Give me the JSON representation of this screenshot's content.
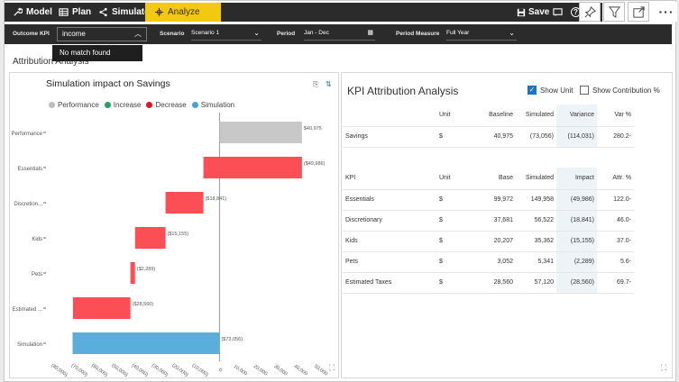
{
  "toolbar": {
    "model": "Model",
    "plan": "Plan",
    "simulate": "Simulate",
    "analyze": "Analyze",
    "save": "Save",
    "help": "?"
  },
  "filters": {
    "outcome_kpi_label": "Outcome KPI",
    "outcome_kpi_value": "income",
    "dropdown_message": "No match found",
    "scenario_label": "Scenario",
    "scenario_value": "Scenario 1",
    "period_label": "Period",
    "period_value": "Jan - Dec",
    "period_measure_label": "Period Measure",
    "period_measure_value": "Full Year"
  },
  "section_title": "Attribution Analysis",
  "left": {
    "title": "Simulation impact on Savings",
    "legend": [
      {
        "name": "Performance",
        "color": "#bdbdbd"
      },
      {
        "name": "Increase",
        "color": "#21a366"
      },
      {
        "name": "Decrease",
        "color": "#e81123"
      },
      {
        "name": "Simulation",
        "color": "#41a1d9"
      }
    ]
  },
  "chart_data": {
    "type": "bar",
    "orientation": "horizontal-waterfall",
    "categories": [
      "Performance",
      "Essentials",
      "Discretion...",
      "Kids",
      "Pets",
      "Estimated ...",
      "Simulation"
    ],
    "series": [
      {
        "name": "Performance",
        "color": "#c8c8c8",
        "bars": [
          {
            "category": "Performance",
            "start": 0,
            "end": 40975,
            "label": "$40,975"
          }
        ]
      },
      {
        "name": "Decrease",
        "color": "#fc4f55",
        "bars": [
          {
            "category": "Essentials",
            "start": -8011,
            "end": 40975,
            "label": "($49,986)"
          },
          {
            "category": "Discretion...",
            "start": -26852,
            "end": -8011,
            "label": "($18,841)"
          },
          {
            "category": "Kids",
            "start": -42007,
            "end": -26852,
            "label": "($15,155)"
          },
          {
            "category": "Pets",
            "start": -44296,
            "end": -42007,
            "label": "($2,289)"
          },
          {
            "category": "Estimated ...",
            "start": -72856,
            "end": -44296,
            "label": "($28,560)"
          }
        ]
      },
      {
        "name": "Simulation",
        "color": "#5aaedb",
        "bars": [
          {
            "category": "Simulation",
            "start": -73056,
            "end": 0,
            "label": "($73,056)"
          }
        ]
      }
    ],
    "xticks": [
      "(80,000)",
      "(70,000)",
      "(60,000)",
      "(50,000)",
      "(40,000)",
      "(30,000)",
      "(20,000)",
      "(10,000)",
      "0",
      "10,000",
      "20,000",
      "30,000",
      "40,000",
      "50,000"
    ],
    "xlim": [
      -80000,
      50000
    ]
  },
  "right": {
    "title": "KPI Attribution Analysis",
    "show_unit": "Show Unit",
    "show_contribution": "Show Contribution %",
    "summary_headers": [
      "",
      "Unit",
      "Baseline",
      "Simulated",
      "Variance",
      "Var %"
    ],
    "summary_rows": [
      [
        "Savings",
        "$",
        "40,975",
        "(73,056)",
        "(114,031)",
        "280.2-"
      ]
    ],
    "kpi_headers": [
      "KPI",
      "Unit",
      "Base",
      "Simulated",
      "Impact",
      "Attr. %"
    ],
    "kpi_rows": [
      [
        "Essentials",
        "$",
        "99,972",
        "149,958",
        "(49,986)",
        "122.0-"
      ],
      [
        "Discretionary",
        "$",
        "37,681",
        "56,522",
        "(18,841)",
        "46.0-"
      ],
      [
        "Kids",
        "$",
        "20,207",
        "35,362",
        "(15,155)",
        "37.0-"
      ],
      [
        "Pets",
        "$",
        "3,052",
        "5,341",
        "(2,289)",
        "5.6-"
      ],
      [
        "Estimated Taxes",
        "$",
        "28,560",
        "57,120",
        "(28,560)",
        "69.7-"
      ]
    ]
  }
}
